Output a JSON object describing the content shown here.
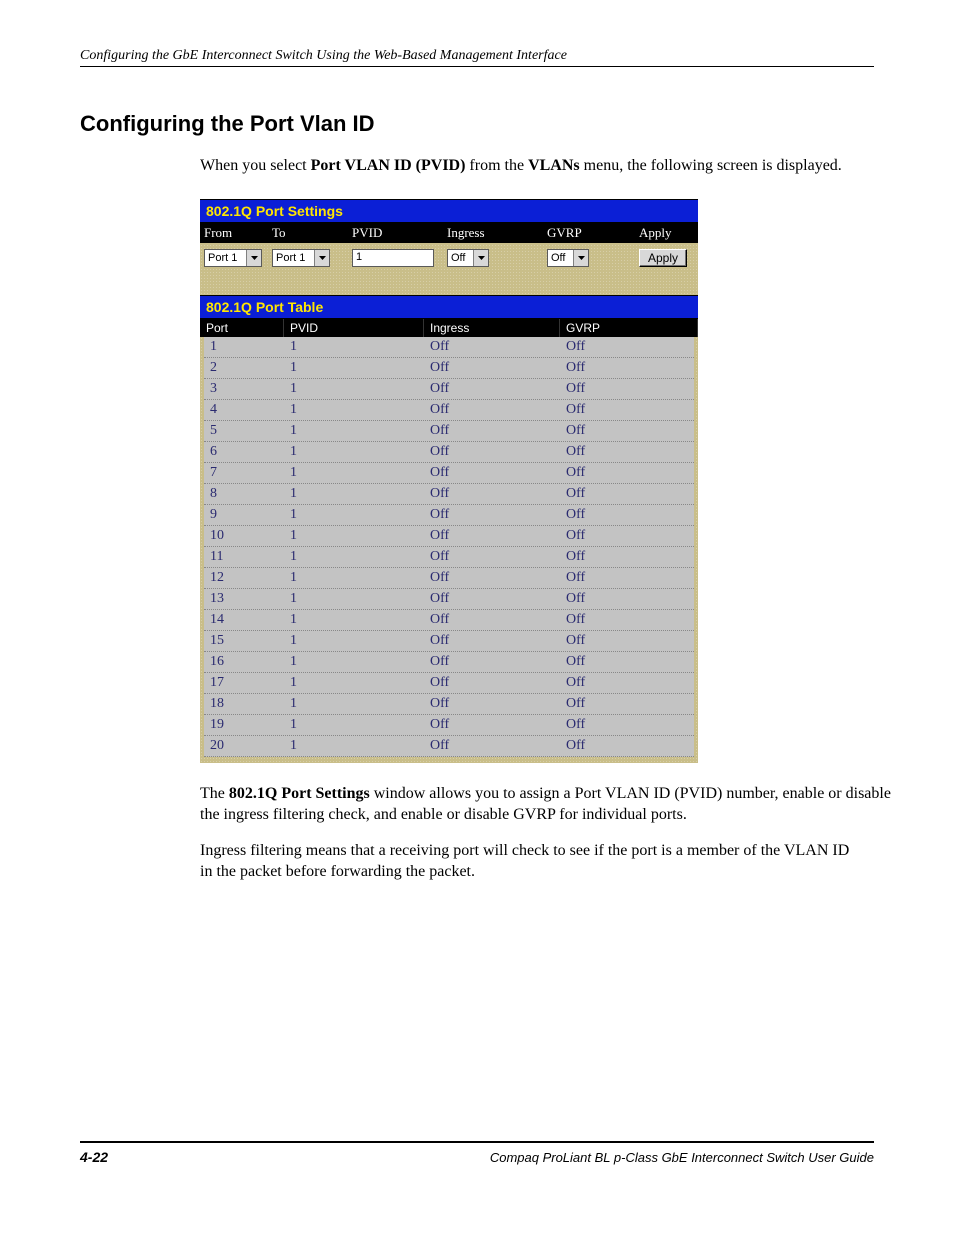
{
  "running_header": "Configuring the GbE Interconnect Switch Using the Web-Based Management Interface",
  "section_title": "Configuring the Port Vlan ID",
  "intro": {
    "pre": "When you select ",
    "bold1": "Port VLAN ID (PVID)",
    "mid": " from the ",
    "bold2": "VLANs",
    "post": " menu, the following screen is displayed."
  },
  "settings": {
    "title": "802.1Q Port Settings",
    "headers": {
      "from": "From",
      "to": "To",
      "pvid": "PVID",
      "ingress": "Ingress",
      "gvrp": "GVRP",
      "apply": "Apply"
    },
    "values": {
      "from": "Port 1",
      "to": "Port 1",
      "pvid": "1",
      "ingress": "Off",
      "gvrp": "Off"
    },
    "apply_button": "Apply"
  },
  "table": {
    "title": "802.1Q Port Table",
    "headers": {
      "port": "Port",
      "pvid": "PVID",
      "ingress": "Ingress",
      "gvrp": "GVRP"
    },
    "rows": [
      {
        "port": "1",
        "pvid": "1",
        "ingress": "Off",
        "gvrp": "Off"
      },
      {
        "port": "2",
        "pvid": "1",
        "ingress": "Off",
        "gvrp": "Off"
      },
      {
        "port": "3",
        "pvid": "1",
        "ingress": "Off",
        "gvrp": "Off"
      },
      {
        "port": "4",
        "pvid": "1",
        "ingress": "Off",
        "gvrp": "Off"
      },
      {
        "port": "5",
        "pvid": "1",
        "ingress": "Off",
        "gvrp": "Off"
      },
      {
        "port": "6",
        "pvid": "1",
        "ingress": "Off",
        "gvrp": "Off"
      },
      {
        "port": "7",
        "pvid": "1",
        "ingress": "Off",
        "gvrp": "Off"
      },
      {
        "port": "8",
        "pvid": "1",
        "ingress": "Off",
        "gvrp": "Off"
      },
      {
        "port": "9",
        "pvid": "1",
        "ingress": "Off",
        "gvrp": "Off"
      },
      {
        "port": "10",
        "pvid": "1",
        "ingress": "Off",
        "gvrp": "Off"
      },
      {
        "port": "11",
        "pvid": "1",
        "ingress": "Off",
        "gvrp": "Off"
      },
      {
        "port": "12",
        "pvid": "1",
        "ingress": "Off",
        "gvrp": "Off"
      },
      {
        "port": "13",
        "pvid": "1",
        "ingress": "Off",
        "gvrp": "Off"
      },
      {
        "port": "14",
        "pvid": "1",
        "ingress": "Off",
        "gvrp": "Off"
      },
      {
        "port": "15",
        "pvid": "1",
        "ingress": "Off",
        "gvrp": "Off"
      },
      {
        "port": "16",
        "pvid": "1",
        "ingress": "Off",
        "gvrp": "Off"
      },
      {
        "port": "17",
        "pvid": "1",
        "ingress": "Off",
        "gvrp": "Off"
      },
      {
        "port": "18",
        "pvid": "1",
        "ingress": "Off",
        "gvrp": "Off"
      },
      {
        "port": "19",
        "pvid": "1",
        "ingress": "Off",
        "gvrp": "Off"
      },
      {
        "port": "20",
        "pvid": "1",
        "ingress": "Off",
        "gvrp": "Off"
      }
    ]
  },
  "para2": {
    "pre": "The ",
    "bold": "802.1Q Port Settings",
    "post": " window allows you to assign a Port VLAN ID (PVID) number, enable or disable the ingress filtering check, and enable or disable GVRP for individual ports."
  },
  "para3": "Ingress filtering means that a receiving port will check to see if the port is a member of the VLAN ID in the packet before forwarding the packet.",
  "footer": {
    "page": "4-22",
    "doc": "Compaq ProLiant BL p-Class GbE Interconnect Switch User Guide"
  }
}
